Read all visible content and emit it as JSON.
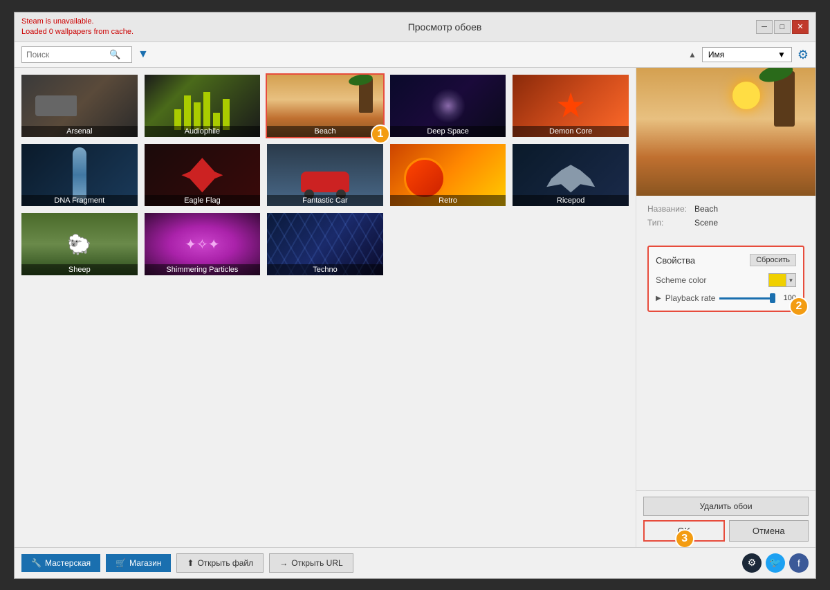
{
  "window": {
    "title": "Просмотр обоев",
    "title_bar_warning_line1": "Steam is unavailable.",
    "title_bar_warning_line2": "Loaded 0 wallpapers from cache."
  },
  "toolbar": {
    "search_placeholder": "Поиск",
    "sort_label": "Имя"
  },
  "wallpapers": [
    {
      "id": "arsenal",
      "label": "Arsenal",
      "theme": "arsenal"
    },
    {
      "id": "audiophile",
      "label": "Audiophile",
      "theme": "audiophile"
    },
    {
      "id": "beach",
      "label": "Beach",
      "theme": "beach",
      "selected": true
    },
    {
      "id": "deepspace",
      "label": "Deep Space",
      "theme": "deepspace"
    },
    {
      "id": "demoncore",
      "label": "Demon Core",
      "theme": "demoncore"
    },
    {
      "id": "dnafragment",
      "label": "DNA Fragment",
      "theme": "dnafragment"
    },
    {
      "id": "eagleflag",
      "label": "Eagle Flag",
      "theme": "eagleflag"
    },
    {
      "id": "fantasticcar",
      "label": "Fantastic Car",
      "theme": "fantasticcar"
    },
    {
      "id": "retro",
      "label": "Retro",
      "theme": "retro"
    },
    {
      "id": "ricepod",
      "label": "Ricepod",
      "theme": "ricepod"
    },
    {
      "id": "sheep",
      "label": "Sheep",
      "theme": "sheep"
    },
    {
      "id": "shimmering",
      "label": "Shimmering Particles",
      "theme": "shimmering"
    },
    {
      "id": "techno",
      "label": "Techno",
      "theme": "techno"
    }
  ],
  "preview": {
    "name_label": "Название:",
    "name_value": "Beach",
    "type_label": "Тип:",
    "type_value": "Scene",
    "props_title": "Свойства",
    "reset_label": "Сбросить",
    "scheme_color_label": "Scheme color",
    "playback_label": "Playback rate",
    "playback_value": "100"
  },
  "bottom": {
    "workshop_label": "Мастерская",
    "shop_label": "Магазин",
    "open_file_label": "Открыть файл",
    "open_url_label": "Открыть URL",
    "delete_label": "Удалить обои",
    "ok_label": "OK",
    "cancel_label": "Отмена"
  },
  "badges": {
    "b1": "1",
    "b2": "2",
    "b3": "3"
  }
}
